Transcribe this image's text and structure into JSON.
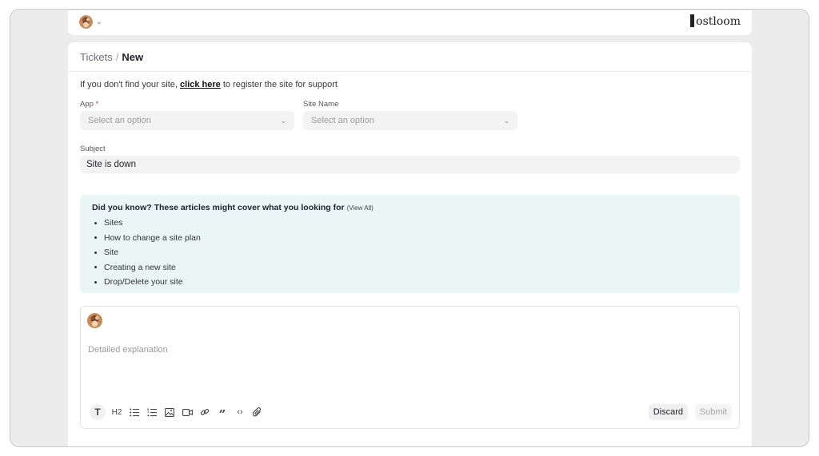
{
  "breadcrumb": {
    "parent": "Tickets",
    "separator": "/",
    "current": "New"
  },
  "logo": {
    "text": "ostloom"
  },
  "notice": {
    "prefix": "If you don't find your site, ",
    "link": "click here",
    "suffix": " to register the site for support"
  },
  "form": {
    "app": {
      "label": "App",
      "required_mark": "*",
      "placeholder": "Select an option"
    },
    "site_name": {
      "label": "Site Name",
      "placeholder": "Select an option"
    },
    "subject": {
      "label": "Subject",
      "value": "Site is down"
    }
  },
  "kb": {
    "title": "Did you know? These articles might cover what you looking for",
    "view_all": "(View All)",
    "items": [
      "Sites",
      "How to change a site plan",
      "Site",
      "Creating a new site",
      "Drop/Delete your site"
    ]
  },
  "editor": {
    "placeholder": "Detailed explanation",
    "toolbar": [
      "text-icon",
      "heading-2-icon",
      "bullet-list-icon",
      "numbered-list-icon",
      "image-icon",
      "video-icon",
      "link-icon",
      "quote-icon",
      "code-icon",
      "attachment-icon"
    ],
    "text_label": "T",
    "h2_label": "H2",
    "quote_label": "”",
    "code_label": "‹›",
    "discard_label": "Discard",
    "submit_label": "Submit"
  },
  "colors": {
    "accent_bg": "#eaf6f6",
    "required": "#e03636"
  }
}
